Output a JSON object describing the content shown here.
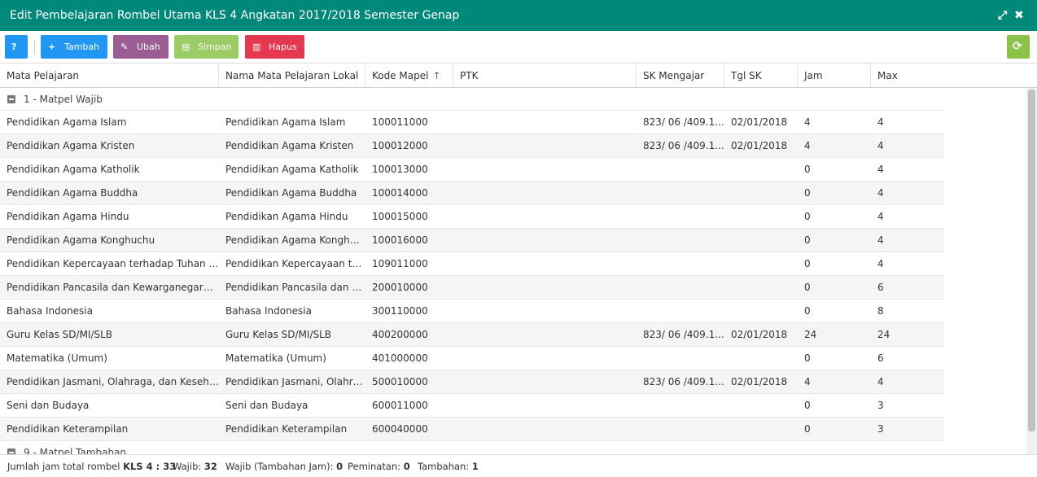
{
  "window": {
    "title": "Edit Pembelajaran Rombel Utama KLS 4 Angkatan 2017/2018 Semester Genap",
    "maximize_glyph": "⤢",
    "close_glyph": "✖"
  },
  "toolbar": {
    "help_glyph": "?",
    "add": {
      "glyph": "+",
      "label": "Tambah"
    },
    "edit": {
      "glyph": "✎",
      "label": "Ubah"
    },
    "save": {
      "glyph": "▤",
      "label": "Simpan"
    },
    "delete": {
      "glyph": "▥",
      "label": "Hapus"
    },
    "refresh_glyph": "⟳"
  },
  "colors": {
    "titlebar": "#00897b",
    "help": "#2196f3",
    "add": "#2196f3",
    "edit": "#9c5c94",
    "save": "#9ccc65",
    "delete": "#e53950",
    "refresh": "#8bc34a"
  },
  "columns": [
    "Mata Pelajaran",
    "Nama Mata Pelajaran Lokal",
    "Kode Mapel",
    "PTK",
    "SK Mengajar",
    "Tgl SK",
    "Jam",
    "Max"
  ],
  "sort_glyph": "↑",
  "groups": [
    {
      "label": "1 - Matpel Wajib",
      "rows": [
        {
          "mapel": "Pendidikan Agama Islam",
          "lokal": "Pendidikan Agama Islam",
          "kode": "100011000",
          "ptk": "",
          "sk": "823/ 06 /409.1...",
          "tgl": "02/01/2018",
          "jam": "4",
          "max": "4"
        },
        {
          "mapel": "Pendidikan Agama Kristen",
          "lokal": "Pendidikan Agama Kristen",
          "kode": "100012000",
          "ptk": "",
          "sk": "823/ 06 /409.1...",
          "tgl": "02/01/2018",
          "jam": "4",
          "max": "4"
        },
        {
          "mapel": "Pendidikan Agama Katholik",
          "lokal": "Pendidikan Agama Katholik",
          "kode": "100013000",
          "ptk": "",
          "sk": "",
          "tgl": "",
          "jam": "0",
          "max": "4"
        },
        {
          "mapel": "Pendidikan Agama Buddha",
          "lokal": "Pendidikan Agama Buddha",
          "kode": "100014000",
          "ptk": "",
          "sk": "",
          "tgl": "",
          "jam": "0",
          "max": "4"
        },
        {
          "mapel": "Pendidikan Agama Hindu",
          "lokal": "Pendidikan Agama Hindu",
          "kode": "100015000",
          "ptk": "",
          "sk": "",
          "tgl": "",
          "jam": "0",
          "max": "4"
        },
        {
          "mapel": "Pendidikan Agama Konghuchu",
          "lokal": "Pendidikan Agama Konghuc...",
          "kode": "100016000",
          "ptk": "",
          "sk": "",
          "tgl": "",
          "jam": "0",
          "max": "4"
        },
        {
          "mapel": "Pendidikan Kepercayaan terhadap Tuhan YME",
          "lokal": "Pendidikan Kepercayaan te...",
          "kode": "109011000",
          "ptk": "",
          "sk": "",
          "tgl": "",
          "jam": "0",
          "max": "4"
        },
        {
          "mapel": "Pendidikan Pancasila dan Kewarganegaraan",
          "lokal": "Pendidikan Pancasila dan K...",
          "kode": "200010000",
          "ptk": "",
          "sk": "",
          "tgl": "",
          "jam": "0",
          "max": "6"
        },
        {
          "mapel": "Bahasa Indonesia",
          "lokal": "Bahasa Indonesia",
          "kode": "300110000",
          "ptk": "",
          "sk": "",
          "tgl": "",
          "jam": "0",
          "max": "8"
        },
        {
          "mapel": "Guru Kelas SD/MI/SLB",
          "lokal": "Guru Kelas SD/MI/SLB",
          "kode": "400200000",
          "ptk": "",
          "sk": "823/ 06 /409.1...",
          "tgl": "02/01/2018",
          "jam": "24",
          "max": "24"
        },
        {
          "mapel": "Matematika (Umum)",
          "lokal": "Matematika (Umum)",
          "kode": "401000000",
          "ptk": "",
          "sk": "",
          "tgl": "",
          "jam": "0",
          "max": "6"
        },
        {
          "mapel": "Pendidikan Jasmani, Olahraga, dan Kesehatan",
          "lokal": "Pendidikan Jasmani, Olahra...",
          "kode": "500010000",
          "ptk": "",
          "sk": "823/ 06 /409.1...",
          "tgl": "02/01/2018",
          "jam": "4",
          "max": "4"
        },
        {
          "mapel": "Seni dan Budaya",
          "lokal": "Seni dan Budaya",
          "kode": "600011000",
          "ptk": "",
          "sk": "",
          "tgl": "",
          "jam": "0",
          "max": "3"
        },
        {
          "mapel": "Pendidikan Keterampilan",
          "lokal": "Pendidikan Keterampilan",
          "kode": "600040000",
          "ptk": "",
          "sk": "",
          "tgl": "",
          "jam": "0",
          "max": "3"
        }
      ]
    },
    {
      "label": "9 - Matpel Tambahan",
      "rows": []
    }
  ],
  "footer": {
    "total_label": "Jumlah jam total rombel",
    "total_class": "KLS 4 : 33",
    "wajib_label": "Wajib:",
    "wajib_value": "32",
    "wajib_tambahan_label": "Wajib (Tambahan Jam):",
    "wajib_tambahan_value": "0",
    "peminatan_label": "Peminatan:",
    "peminatan_value": "0",
    "tambahan_label": "Tambahan:",
    "tambahan_value": "1"
  }
}
